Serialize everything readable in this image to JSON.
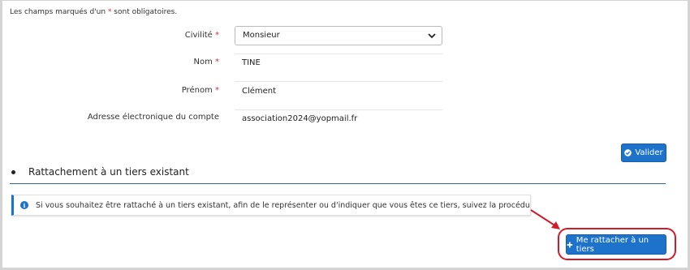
{
  "form": {
    "mandatory_note_prefix": "Les champs marqués d'un ",
    "mandatory_note_star": "*",
    "mandatory_note_suffix": " sont obligatoires.",
    "required_star": "*",
    "civilite": {
      "label": "Civilité",
      "value": "Monsieur"
    },
    "nom": {
      "label": "Nom",
      "value": "TINE"
    },
    "prenom": {
      "label": "Prénom",
      "value": "Clément"
    },
    "email": {
      "label": "Adresse électronique du compte",
      "value": "association2024@yopmail.fr"
    },
    "validate_label": "Valider"
  },
  "section": {
    "title": "Rattachement à un tiers existant",
    "info_text": "Si vous souhaitez être rattaché à un tiers existant, afin de le représenter ou d'indiquer que vous êtes ce tiers, suivez la procédure de rattachement.",
    "attach_label": "Me rattacher à un tiers"
  },
  "colors": {
    "primary": "#1d73c9",
    "required": "#d32f2f",
    "annotation": "#d11a2a"
  },
  "icons": {
    "validate": "check-circle-icon",
    "attach": "plus-icon",
    "info": "info-icon",
    "select": "chevron-down-icon"
  }
}
